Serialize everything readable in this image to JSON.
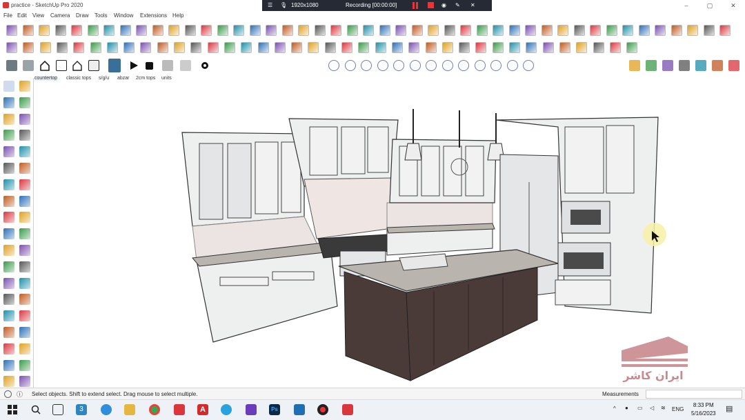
{
  "window": {
    "title": "practice - SketchUp Pro 2020",
    "minimize": "–",
    "maximize": "▢",
    "close": "✕"
  },
  "recorder": {
    "resolution": "1920x1080",
    "status": "Recording [00:00:00]"
  },
  "menu": [
    "File",
    "Edit",
    "View",
    "Camera",
    "Draw",
    "Tools",
    "Window",
    "Extensions",
    "Help"
  ],
  "scene_tabs": [
    "countertop",
    "classic tops",
    "s/g/u",
    "abzar",
    "2cm tops",
    "units"
  ],
  "active_scene_tab": 0,
  "status": {
    "hint": "Select objects. Shift to extend select. Drag mouse to select multiple.",
    "measurements_label": "Measurements",
    "measurements_value": ""
  },
  "watermark": {
    "text": "ایران کاشر"
  },
  "taskbar": {
    "badge": "3",
    "language": "ENG",
    "time": "8:33 PM",
    "date": "5/16/2023"
  },
  "colors": {
    "accent_red": "#d9363e",
    "recorder_bg": "#262a34",
    "island": "#4a3b38",
    "countertop": "#b9b4ae",
    "cabinet": "#eeefef",
    "watermark": "#c98a8f"
  }
}
